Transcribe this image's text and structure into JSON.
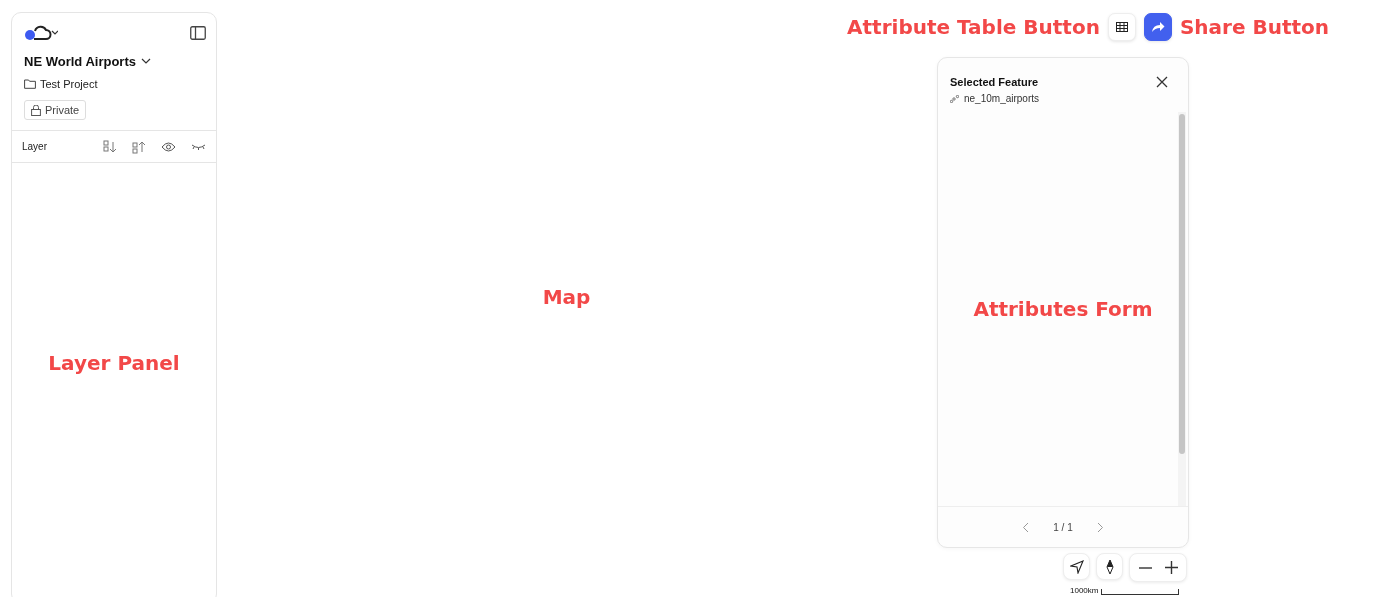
{
  "layer_panel": {
    "project_title": "NE World Airports",
    "folder": "Test Project",
    "visibility_badge": "Private",
    "layer_header": "Layer",
    "annotation": "Layer Panel"
  },
  "map": {
    "annotation": "Map"
  },
  "toolbar": {
    "attribute_table_annotation": "Attribute Table Button",
    "share_annotation": "Share Button"
  },
  "feature_panel": {
    "title": "Selected Feature",
    "layer_name": "ne_10m_airports",
    "annotation": "Attributes Form",
    "pager": "1 / 1"
  },
  "scale_bar": {
    "label": "1000km"
  }
}
